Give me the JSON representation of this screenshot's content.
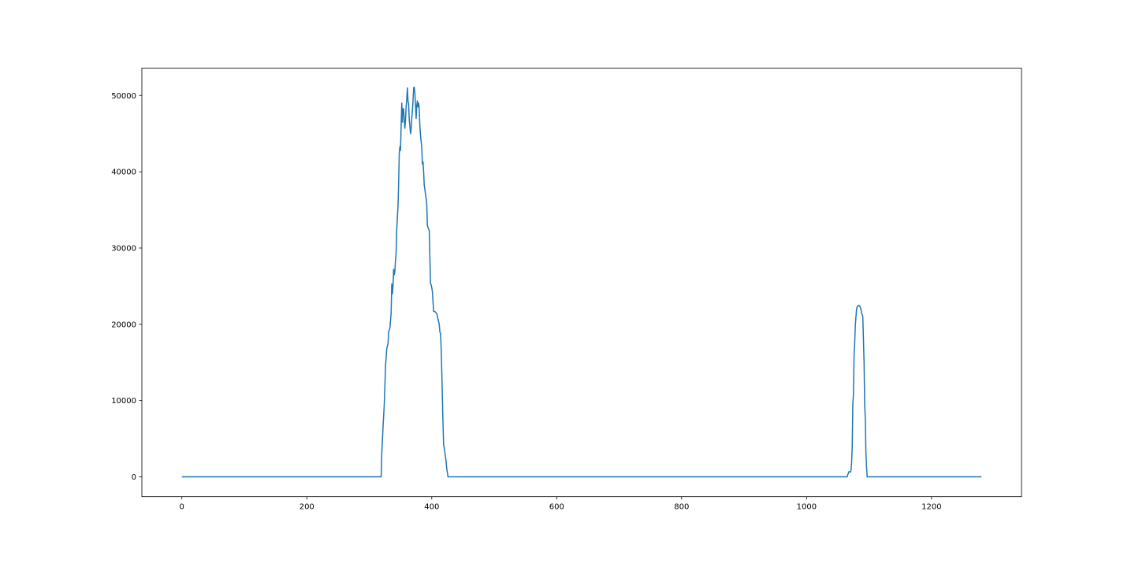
{
  "chart_data": {
    "type": "line",
    "title": "",
    "xlabel": "",
    "ylabel": "",
    "xlim": [
      -64,
      1344
    ],
    "ylim": [
      -2600,
      53600
    ],
    "grid": false,
    "legend": "none",
    "xticks": [
      0,
      200,
      400,
      600,
      800,
      1000,
      1200
    ],
    "yticks": [
      0,
      10000,
      20000,
      30000,
      40000,
      50000
    ],
    "xtick_labels": [
      "0",
      "200",
      "400",
      "600",
      "800",
      "1000",
      "1200"
    ],
    "ytick_labels": [
      "0",
      "10000",
      "20000",
      "30000",
      "40000",
      "50000"
    ],
    "series": [
      {
        "color": "#1f77b4",
        "points": [
          [
            0,
            0
          ],
          [
            319,
            0
          ],
          [
            320,
            3000
          ],
          [
            322,
            6500
          ],
          [
            324,
            9500
          ],
          [
            326,
            14500
          ],
          [
            328,
            16800
          ],
          [
            330,
            17500
          ],
          [
            331,
            19000
          ],
          [
            333,
            19500
          ],
          [
            335,
            21500
          ],
          [
            336,
            25300
          ],
          [
            337,
            24000
          ],
          [
            338,
            25000
          ],
          [
            339,
            27200
          ],
          [
            340,
            26500
          ],
          [
            341,
            27000
          ],
          [
            342,
            28500
          ],
          [
            343,
            29300
          ],
          [
            344,
            32500
          ],
          [
            346,
            35500
          ],
          [
            347,
            38500
          ],
          [
            348,
            42500
          ],
          [
            349,
            43300
          ],
          [
            350,
            42800
          ],
          [
            351,
            46000
          ],
          [
            352,
            49000
          ],
          [
            353,
            46500
          ],
          [
            354,
            48300
          ],
          [
            355,
            48200
          ],
          [
            356,
            46800
          ],
          [
            357,
            45700
          ],
          [
            358,
            46800
          ],
          [
            359,
            48500
          ],
          [
            360,
            49600
          ],
          [
            361,
            51000
          ],
          [
            362,
            49300
          ],
          [
            363,
            48800
          ],
          [
            364,
            46800
          ],
          [
            365,
            46000
          ],
          [
            366,
            45000
          ],
          [
            367,
            45600
          ],
          [
            368,
            47000
          ],
          [
            369,
            48000
          ],
          [
            370,
            49300
          ],
          [
            371,
            51000
          ],
          [
            372,
            51100
          ],
          [
            373,
            50300
          ],
          [
            374,
            48800
          ],
          [
            375,
            47000
          ],
          [
            376,
            48700
          ],
          [
            377,
            49300
          ],
          [
            378,
            48500
          ],
          [
            379,
            49000
          ],
          [
            380,
            48200
          ],
          [
            381,
            46000
          ],
          [
            382,
            44800
          ],
          [
            384,
            43200
          ],
          [
            385,
            41000
          ],
          [
            386,
            41300
          ],
          [
            387,
            40000
          ],
          [
            388,
            38200
          ],
          [
            389,
            37700
          ],
          [
            390,
            37000
          ],
          [
            391,
            36500
          ],
          [
            392,
            35800
          ],
          [
            393,
            33000
          ],
          [
            394,
            32700
          ],
          [
            395,
            32500
          ],
          [
            396,
            32300
          ],
          [
            397,
            28800
          ],
          [
            398,
            25300
          ],
          [
            399,
            25200
          ],
          [
            400,
            24800
          ],
          [
            401,
            24300
          ],
          [
            402,
            23000
          ],
          [
            403,
            21700
          ],
          [
            404,
            21700
          ],
          [
            406,
            21600
          ],
          [
            408,
            21400
          ],
          [
            410,
            20700
          ],
          [
            412,
            20000
          ],
          [
            413,
            19000
          ],
          [
            414,
            18800
          ],
          [
            415,
            17000
          ],
          [
            416,
            14000
          ],
          [
            418,
            7000
          ],
          [
            419,
            4200
          ],
          [
            420,
            3800
          ],
          [
            421,
            3200
          ],
          [
            423,
            2000
          ],
          [
            424,
            1100
          ],
          [
            426,
            0
          ],
          [
            1065,
            0
          ],
          [
            1066,
            300
          ],
          [
            1068,
            700
          ],
          [
            1070,
            600
          ],
          [
            1071,
            800
          ],
          [
            1072,
            1800
          ],
          [
            1073,
            3800
          ],
          [
            1074,
            9500
          ],
          [
            1075,
            10800
          ],
          [
            1076,
            16000
          ],
          [
            1077,
            17500
          ],
          [
            1078,
            19800
          ],
          [
            1079,
            21000
          ],
          [
            1080,
            22000
          ],
          [
            1081,
            22300
          ],
          [
            1083,
            22500
          ],
          [
            1085,
            22400
          ],
          [
            1087,
            22000
          ],
          [
            1088,
            21500
          ],
          [
            1090,
            21000
          ],
          [
            1092,
            15000
          ],
          [
            1093,
            9500
          ],
          [
            1094,
            7500
          ],
          [
            1095,
            3000
          ],
          [
            1096,
            1200
          ],
          [
            1097,
            0
          ],
          [
            1280,
            0
          ]
        ]
      }
    ]
  }
}
